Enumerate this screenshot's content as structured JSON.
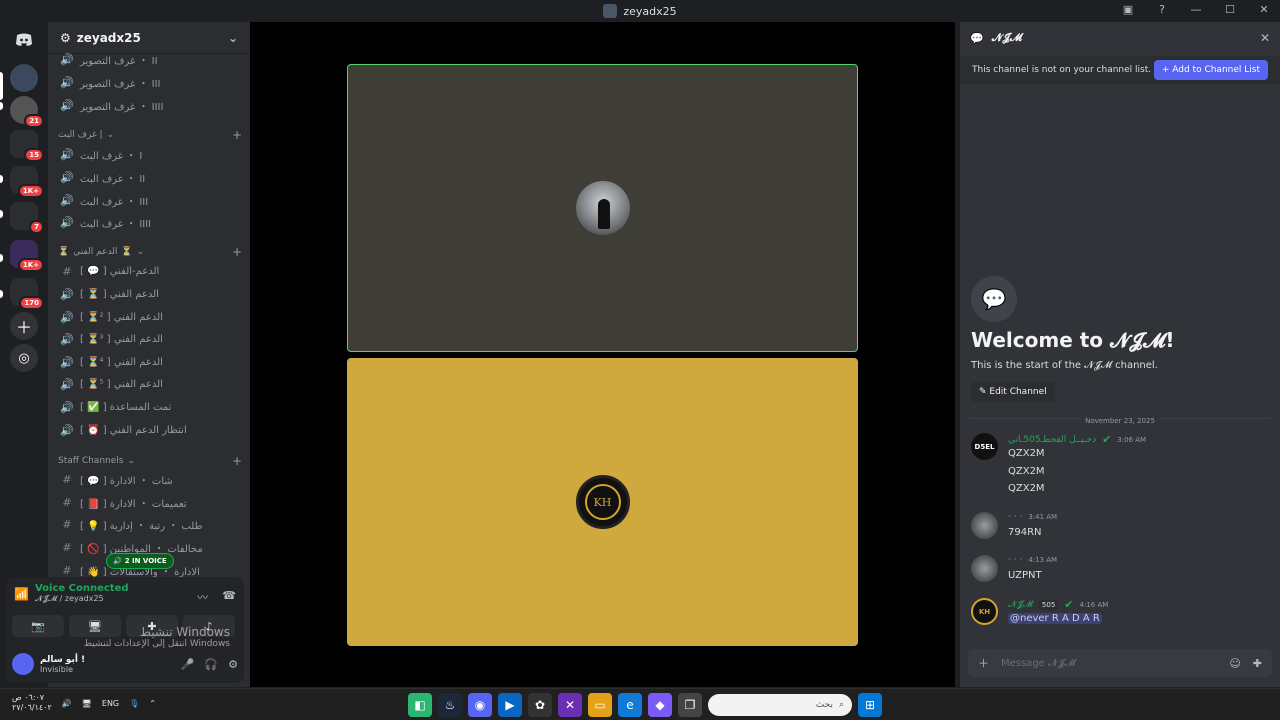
{
  "window": {
    "title": "zeyadx25",
    "help_icon": "?"
  },
  "guilds": [
    {
      "icon": "discord-icon",
      "badge": ""
    },
    {
      "badge": ""
    },
    {
      "badge": "21"
    },
    {
      "badge": "15"
    },
    {
      "badge": "1K+"
    },
    {
      "badge": "7"
    },
    {
      "badge": "1K+"
    },
    {
      "badge": "170"
    }
  ],
  "sidebar": {
    "server_name": "zeyadx25",
    "channels_a": [
      {
        "name": "غرف التصوير ・ II"
      },
      {
        "name": "غرف التصوير ・ III"
      },
      {
        "name": "غرف التصوير ・ IIII"
      }
    ],
    "cat_stream": "غرف البث |",
    "channels_b": [
      {
        "name": "غرف البث ・ I"
      },
      {
        "name": "غرف البث ・ II"
      },
      {
        "name": "غرف البث ・ III"
      },
      {
        "name": "غرف البث ・ IIII"
      }
    ],
    "cat_support": "الدعم الفني",
    "channels_c": [
      {
        "name": "[ 💬 ] الدعم-الفني",
        "type": "text"
      },
      {
        "name": "[ ⏳ ] الدعم الفني",
        "type": "voice"
      },
      {
        "name": "[ ⏳² ] الدعم الفني",
        "type": "voice"
      },
      {
        "name": "[ ⏳³ ] الدعم الفني",
        "type": "voice"
      },
      {
        "name": "[ ⏳⁴ ] الدعم الفني",
        "type": "voice"
      },
      {
        "name": "[ ⏳⁵ ] الدعم الفني",
        "type": "voice"
      },
      {
        "name": "[ ✅ ] تمت المساعدة",
        "type": "voice"
      },
      {
        "name": "[ ⏰ ] انتظار الدعم الفني",
        "type": "voice"
      }
    ],
    "cat_staff": "Staff Channels",
    "channels_d": [
      {
        "name": "[ 💬 ] شات ・ الادارة"
      },
      {
        "name": "[ 📕 ] تعميمات ・ الادارة"
      },
      {
        "name": "[ 💡 ] طلب ・ رتبة ・ إدارية"
      },
      {
        "name": "[ 🚫 ] مخالفات ・ المواطنين"
      },
      {
        "name": "[ 👋 ] الادارة ・ والاستقالات"
      }
    ],
    "voice_chip": "2 IN VOICE"
  },
  "voice_panel": {
    "status": "Voice Connected",
    "channel": "𝓝𝓙𝓜 / zeyadx25",
    "user_name": "أبو سالم !",
    "user_status": "Invisible"
  },
  "watermark": {
    "line1": "تنشيط Windows",
    "line2": "انتقل إلى الإعدادات لتنشيط Windows"
  },
  "chat": {
    "channel_name": "𝓝𝓙𝓜",
    "notice": "This channel is not on your channel list.",
    "add_button": "+ Add to Channel List",
    "welcome_title": "Welcome to 𝓝𝓙𝓜!",
    "welcome_sub": "This is the start of the 𝓝𝓙𝓜 channel.",
    "edit_button": "✎ Edit Channel",
    "date": "November 23, 2025",
    "messages": [
      {
        "avatar": "D5EL",
        "name": "دخـيــل القحطـ505ـاني",
        "time": "3:06 AM",
        "lines": [
          "QZX2M",
          "QZX2M",
          "QZX2M"
        ]
      },
      {
        "avatar": "",
        "name": "",
        "time": "3:41 AM",
        "lines": [
          "794RN"
        ]
      },
      {
        "avatar": "",
        "name": "",
        "time": "4:13 AM",
        "lines": [
          "UZPNT"
        ]
      },
      {
        "avatar": "KH",
        "name": "𝓝𝓙𝓜",
        "tag": "505",
        "time": "4:16 AM",
        "lines": [
          "@never R A D A R"
        ]
      }
    ],
    "composer_placeholder": "Message 𝓝𝓙𝓜"
  },
  "taskbar": {
    "lang": "ENG",
    "time": "٠٦:٠٧ ص",
    "date": "٢٧/٠٦/١٤٠٢",
    "search_placeholder": "بحث"
  },
  "stage": {
    "tile2_logo": "KH"
  }
}
